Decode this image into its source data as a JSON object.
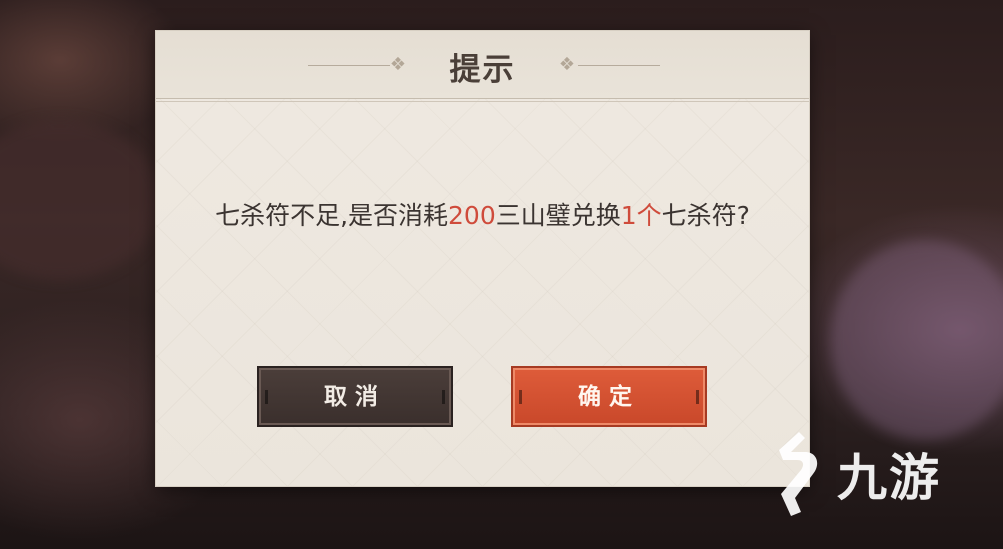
{
  "dialog": {
    "title": "提示",
    "message": {
      "part1": "七杀符不足,是否消耗",
      "cost": "200",
      "part2": "三山璧兑换",
      "count": "1个",
      "part3": "七杀符?"
    }
  },
  "buttons": {
    "cancel_label": "取消",
    "confirm_label": "确定"
  },
  "watermark": {
    "text": "九游"
  },
  "colors": {
    "highlight": "#cf4b3b",
    "confirm_button": "#d4502f",
    "cancel_button": "#42362f"
  }
}
